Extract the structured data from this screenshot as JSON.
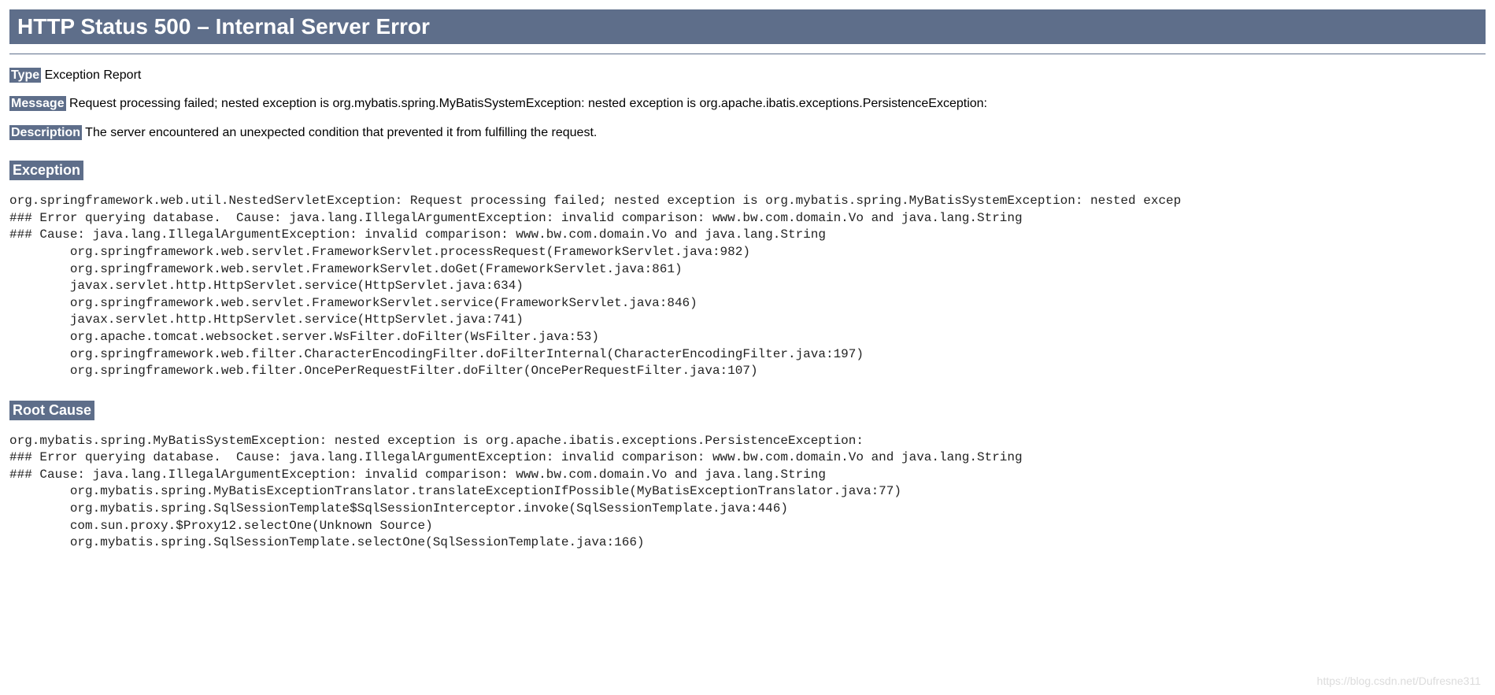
{
  "title": "HTTP Status 500 – Internal Server Error",
  "type": {
    "label": "Type",
    "value": " Exception Report"
  },
  "message": {
    "label": "Message",
    "value": " Request processing failed; nested exception is org.mybatis.spring.MyBatisSystemException: nested exception is org.apache.ibatis.exceptions.PersistenceException:"
  },
  "description": {
    "label": "Description",
    "value": " The server encountered an unexpected condition that prevented it from fulfilling the request."
  },
  "exception": {
    "heading": "Exception",
    "trace": "org.springframework.web.util.NestedServletException: Request processing failed; nested exception is org.mybatis.spring.MyBatisSystemException: nested excep\n### Error querying database.  Cause: java.lang.IllegalArgumentException: invalid comparison: www.bw.com.domain.Vo and java.lang.String\n### Cause: java.lang.IllegalArgumentException: invalid comparison: www.bw.com.domain.Vo and java.lang.String\n        org.springframework.web.servlet.FrameworkServlet.processRequest(FrameworkServlet.java:982)\n        org.springframework.web.servlet.FrameworkServlet.doGet(FrameworkServlet.java:861)\n        javax.servlet.http.HttpServlet.service(HttpServlet.java:634)\n        org.springframework.web.servlet.FrameworkServlet.service(FrameworkServlet.java:846)\n        javax.servlet.http.HttpServlet.service(HttpServlet.java:741)\n        org.apache.tomcat.websocket.server.WsFilter.doFilter(WsFilter.java:53)\n        org.springframework.web.filter.CharacterEncodingFilter.doFilterInternal(CharacterEncodingFilter.java:197)\n        org.springframework.web.filter.OncePerRequestFilter.doFilter(OncePerRequestFilter.java:107)"
  },
  "rootcause": {
    "heading": "Root Cause",
    "trace": "org.mybatis.spring.MyBatisSystemException: nested exception is org.apache.ibatis.exceptions.PersistenceException:\n### Error querying database.  Cause: java.lang.IllegalArgumentException: invalid comparison: www.bw.com.domain.Vo and java.lang.String\n### Cause: java.lang.IllegalArgumentException: invalid comparison: www.bw.com.domain.Vo and java.lang.String\n        org.mybatis.spring.MyBatisExceptionTranslator.translateExceptionIfPossible(MyBatisExceptionTranslator.java:77)\n        org.mybatis.spring.SqlSessionTemplate$SqlSessionInterceptor.invoke(SqlSessionTemplate.java:446)\n        com.sun.proxy.$Proxy12.selectOne(Unknown Source)\n        org.mybatis.spring.SqlSessionTemplate.selectOne(SqlSessionTemplate.java:166)"
  },
  "watermark": "https://blog.csdn.net/Dufresne311"
}
